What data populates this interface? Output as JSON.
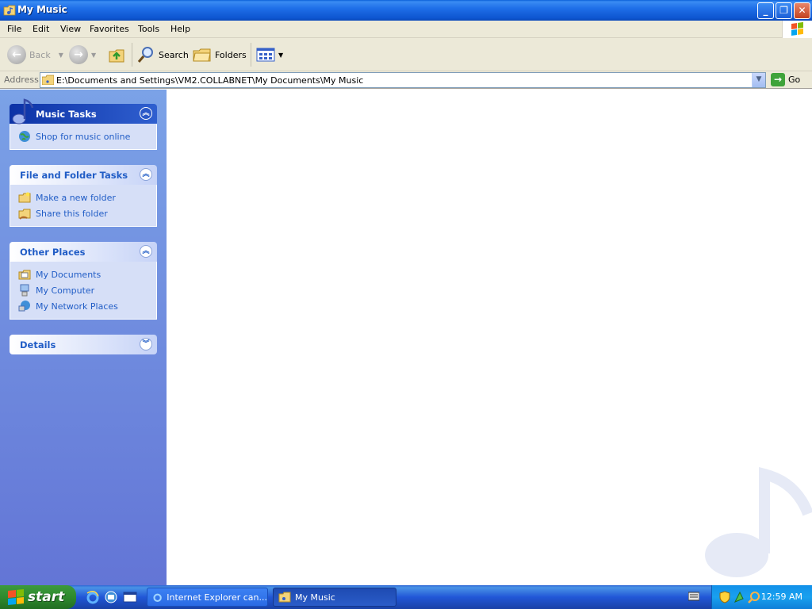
{
  "window": {
    "title": "My Music",
    "buttons": {
      "minimize": "_",
      "maximize": "❐",
      "close": "✕"
    }
  },
  "menubar": [
    "File",
    "Edit",
    "View",
    "Favorites",
    "Tools",
    "Help"
  ],
  "toolbar": {
    "back_label": "Back",
    "search_label": "Search",
    "folders_label": "Folders"
  },
  "address": {
    "label": "Address",
    "value": "E:\\Documents and Settings\\VM2.COLLABNET\\My Documents\\My Music",
    "go_label": "Go"
  },
  "left_pane": {
    "music_tasks": {
      "title": "Music Tasks",
      "items": [
        {
          "label": "Shop for music online",
          "icon": "globe-icon"
        }
      ]
    },
    "file_folder_tasks": {
      "title": "File and Folder Tasks",
      "items": [
        {
          "label": "Make a new folder",
          "icon": "new-folder-icon"
        },
        {
          "label": "Share this folder",
          "icon": "share-folder-icon"
        }
      ]
    },
    "other_places": {
      "title": "Other Places",
      "items": [
        {
          "label": "My Documents",
          "icon": "my-documents-icon"
        },
        {
          "label": "My Computer",
          "icon": "my-computer-icon"
        },
        {
          "label": "My Network Places",
          "icon": "network-places-icon"
        }
      ]
    },
    "details": {
      "title": "Details"
    }
  },
  "taskbar": {
    "start_label": "start",
    "tasks": [
      {
        "label": "Internet Explorer can...",
        "active": false
      },
      {
        "label": "My Music",
        "active": true
      }
    ],
    "clock": "12:59 AM"
  },
  "colors": {
    "title_bar": "#0d55d0",
    "left_pane_top": "#7ba2e7",
    "left_pane_bottom": "#6375d6",
    "link": "#215dc6",
    "taskbar": "#2157d7",
    "start_green": "#2e8a2e"
  }
}
